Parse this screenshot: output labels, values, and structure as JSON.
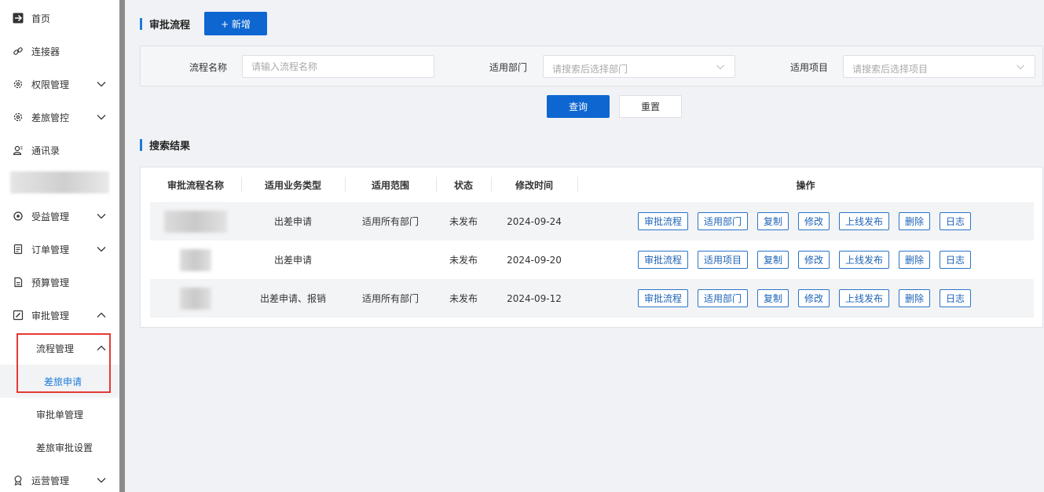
{
  "sidebar": {
    "items": [
      {
        "label": "首页",
        "icon": "plane-icon"
      },
      {
        "label": "连接器",
        "icon": "link-icon"
      },
      {
        "label": "权限管理",
        "icon": "gear-icon"
      },
      {
        "label": "差旅管控",
        "icon": "gear-icon"
      },
      {
        "label": "通讯录",
        "icon": "contacts-icon"
      },
      {
        "label": "受益管理",
        "icon": "coin-icon"
      },
      {
        "label": "订单管理",
        "icon": "order-icon"
      },
      {
        "label": "预算管理",
        "icon": "document-icon"
      },
      {
        "label": "审批管理",
        "icon": "edit-icon"
      },
      {
        "label": "运营管理",
        "icon": "badge-icon"
      }
    ],
    "sub_items": [
      {
        "label": "流程管理"
      },
      {
        "label": "差旅申请"
      },
      {
        "label": "审批单管理"
      },
      {
        "label": "差旅审批设置"
      }
    ]
  },
  "header": {
    "title": "审批流程",
    "add_label": "+ 新增"
  },
  "filter": {
    "name_label": "流程名称",
    "name_placeholder": "请输入流程名称",
    "dept_label": "适用部门",
    "dept_placeholder": "请搜索后选择部门",
    "project_label": "适用项目",
    "project_placeholder": "请搜索后选择项目",
    "query_label": "查询",
    "reset_label": "重置"
  },
  "results": {
    "title": "搜索结果",
    "columns": [
      "审批流程名称",
      "适用业务类型",
      "适用范围",
      "状态",
      "修改时间",
      "操作"
    ],
    "rows": [
      {
        "type": "出差申请",
        "scope": "适用所有部门",
        "status": "未发布",
        "date": "2024-09-24",
        "actions": [
          "审批流程",
          "适用部门",
          "复制",
          "修改",
          "上线发布",
          "删除",
          "日志"
        ]
      },
      {
        "type": "出差申请",
        "scope": "",
        "status": "未发布",
        "date": "2024-09-20",
        "actions": [
          "审批流程",
          "适用项目",
          "复制",
          "修改",
          "上线发布",
          "删除",
          "日志"
        ]
      },
      {
        "type": "出差申请、报销",
        "scope": "适用所有部门",
        "status": "未发布",
        "date": "2024-09-12",
        "actions": [
          "审批流程",
          "适用部门",
          "复制",
          "修改",
          "上线发布",
          "删除",
          "日志"
        ]
      }
    ]
  },
  "colors": {
    "primary": "#0e66d0",
    "active_text": "#1d7bd8",
    "highlight_border": "#e53935"
  }
}
